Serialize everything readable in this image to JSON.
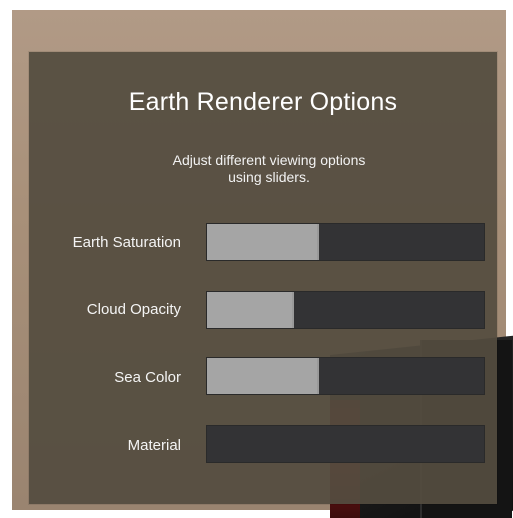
{
  "panel": {
    "title": "Earth Renderer Options",
    "subtitle_line1": "Adjust different viewing options",
    "subtitle_line2": "using sliders."
  },
  "sliders": [
    {
      "label": "Earth Saturation",
      "value": 0.4
    },
    {
      "label": "Cloud Opacity",
      "value": 0.31
    },
    {
      "label": "Sea Color",
      "value": 0.4
    },
    {
      "label": "Material",
      "value": 0.0
    }
  ],
  "colors": {
    "panel_background": "#544c40",
    "slider_track": "#333335",
    "slider_fill": "#a5a5a5",
    "text": "#ffffff"
  }
}
